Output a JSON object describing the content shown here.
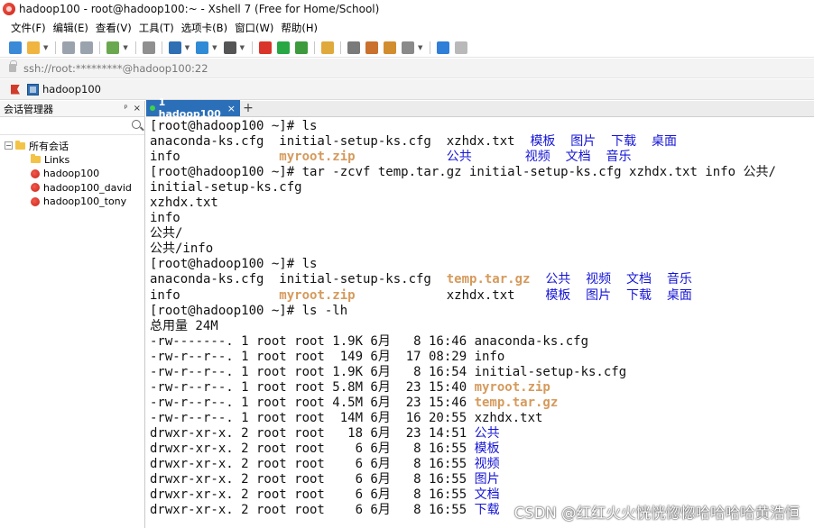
{
  "window": {
    "title": "hadoop100 - root@hadoop100:~ - Xshell 7 (Free for Home/School)"
  },
  "menu": [
    "文件(F)",
    "编辑(E)",
    "查看(V)",
    "工具(T)",
    "选项卡(B)",
    "窗口(W)",
    "帮助(H)"
  ],
  "toolbar": {
    "buttons": [
      {
        "name": "new-session-icon",
        "color": "#3a8ad8"
      },
      {
        "name": "open-folder-icon",
        "color": "#f0b540"
      },
      {
        "name": "connect-icon",
        "color": "#9aa3ad"
      },
      {
        "name": "disconnect-icon",
        "color": "#9aa3ad"
      },
      {
        "name": "reconnect-icon",
        "color": "#6aa84f"
      },
      {
        "name": "find-icon",
        "color": "#8f8f8f"
      },
      {
        "name": "properties-icon",
        "color": "#2f6fb3"
      },
      {
        "name": "globe-icon",
        "color": "#2f8bd6"
      },
      {
        "name": "font-icon",
        "color": "#555555"
      },
      {
        "name": "xshell-icon",
        "color": "#d9352a"
      },
      {
        "name": "xftp-icon",
        "color": "#28a745"
      },
      {
        "name": "fullscreen-icon",
        "color": "#3c9b3c"
      },
      {
        "name": "lock-icon",
        "color": "#e0a93c"
      },
      {
        "name": "keyboard-icon",
        "color": "#7a7a7a"
      },
      {
        "name": "highlight-icon",
        "color": "#c9712d"
      },
      {
        "name": "compose-icon",
        "color": "#d28d2e"
      },
      {
        "name": "layout-icon",
        "color": "#8a8a8a"
      },
      {
        "name": "help-icon",
        "color": "#2f7ed8"
      },
      {
        "name": "chat-icon",
        "color": "#b9b9b9"
      }
    ]
  },
  "address": {
    "text": "ssh://root:*********@hadoop100:22"
  },
  "session_bar": {
    "label": "hadoop100"
  },
  "session_manager": {
    "title": "会话管理器",
    "pin": "ᵖ",
    "close": "×",
    "tree": [
      {
        "label": "所有会话",
        "kind": "root",
        "expander": "−"
      },
      {
        "label": "Links",
        "kind": "folder"
      },
      {
        "label": "hadoop100",
        "kind": "session"
      },
      {
        "label": "hadoop100_david",
        "kind": "session"
      },
      {
        "label": "hadoop100_tony",
        "kind": "session"
      }
    ]
  },
  "tabs": [
    {
      "label": "1 hadoop100",
      "close": "×"
    }
  ],
  "tab_add": "+",
  "terminal": {
    "lines": [
      [
        {
          "t": "[root@hadoop100 ~]# ls"
        }
      ],
      [
        {
          "t": "anaconda-ks.cfg  initial-setup-ks.cfg  xzhdx.txt  "
        },
        {
          "t": "模板",
          "c": "link"
        },
        {
          "t": "  "
        },
        {
          "t": "图片",
          "c": "link"
        },
        {
          "t": "  "
        },
        {
          "t": "下载",
          "c": "link"
        },
        {
          "t": "  "
        },
        {
          "t": "桌面",
          "c": "link"
        }
      ],
      [
        {
          "t": "info             "
        },
        {
          "t": "myroot.zip",
          "c": "orange"
        },
        {
          "t": "            "
        },
        {
          "t": "公共",
          "c": "link"
        },
        {
          "t": "       "
        },
        {
          "t": "视频",
          "c": "link"
        },
        {
          "t": "  "
        },
        {
          "t": "文档",
          "c": "link"
        },
        {
          "t": "  "
        },
        {
          "t": "音乐",
          "c": "link"
        }
      ],
      [
        {
          "t": "[root@hadoop100 ~]# tar -zcvf temp.tar.gz initial-setup-ks.cfg xzhdx.txt info 公共/"
        }
      ],
      [
        {
          "t": "initial-setup-ks.cfg"
        }
      ],
      [
        {
          "t": "xzhdx.txt"
        }
      ],
      [
        {
          "t": "info"
        }
      ],
      [
        {
          "t": "公共/"
        }
      ],
      [
        {
          "t": "公共/info"
        }
      ],
      [
        {
          "t": "[root@hadoop100 ~]# ls"
        }
      ],
      [
        {
          "t": "anaconda-ks.cfg  initial-setup-ks.cfg  "
        },
        {
          "t": "temp.tar.gz",
          "c": "orange"
        },
        {
          "t": "  "
        },
        {
          "t": "公共",
          "c": "link"
        },
        {
          "t": "  "
        },
        {
          "t": "视频",
          "c": "link"
        },
        {
          "t": "  "
        },
        {
          "t": "文档",
          "c": "link"
        },
        {
          "t": "  "
        },
        {
          "t": "音乐",
          "c": "link"
        }
      ],
      [
        {
          "t": "info             "
        },
        {
          "t": "myroot.zip",
          "c": "orange"
        },
        {
          "t": "            xzhdx.txt    "
        },
        {
          "t": "模板",
          "c": "link"
        },
        {
          "t": "  "
        },
        {
          "t": "图片",
          "c": "link"
        },
        {
          "t": "  "
        },
        {
          "t": "下载",
          "c": "link"
        },
        {
          "t": "  "
        },
        {
          "t": "桌面",
          "c": "link"
        }
      ],
      [
        {
          "t": "[root@hadoop100 ~]# ls -lh"
        }
      ],
      [
        {
          "t": "总用量 24M"
        }
      ],
      [
        {
          "t": "-rw-------. 1 root root 1.9K 6月   8 16:46 anaconda-ks.cfg"
        }
      ],
      [
        {
          "t": "-rw-r--r--. 1 root root  149 6月  17 08:29 info"
        }
      ],
      [
        {
          "t": "-rw-r--r--. 1 root root 1.9K 6月   8 16:54 initial-setup-ks.cfg"
        }
      ],
      [
        {
          "t": "-rw-r--r--. 1 root root 5.8M 6月  23 15:40 "
        },
        {
          "t": "myroot.zip",
          "c": "orange"
        }
      ],
      [
        {
          "t": "-rw-r--r--. 1 root root 4.5M 6月  23 15:46 "
        },
        {
          "t": "temp.tar.gz",
          "c": "orange"
        }
      ],
      [
        {
          "t": "-rw-r--r--. 1 root root  14M 6月  16 20:55 xzhdx.txt"
        }
      ],
      [
        {
          "t": "drwxr-xr-x. 2 root root   18 6月  23 14:51 "
        },
        {
          "t": "公共",
          "c": "link"
        }
      ],
      [
        {
          "t": "drwxr-xr-x. 2 root root    6 6月   8 16:55 "
        },
        {
          "t": "模板",
          "c": "link"
        }
      ],
      [
        {
          "t": "drwxr-xr-x. 2 root root    6 6月   8 16:55 "
        },
        {
          "t": "视频",
          "c": "link"
        }
      ],
      [
        {
          "t": "drwxr-xr-x. 2 root root    6 6月   8 16:55 "
        },
        {
          "t": "图片",
          "c": "link"
        }
      ],
      [
        {
          "t": "drwxr-xr-x. 2 root root    6 6月   8 16:55 "
        },
        {
          "t": "文档",
          "c": "link"
        }
      ],
      [
        {
          "t": "drwxr-xr-x. 2 root root    6 6月   8 16:55 "
        },
        {
          "t": "下载",
          "c": "link"
        }
      ]
    ]
  },
  "watermark": "CSDN @红红火火恍恍惚惚哈哈哈哈黄浩恒"
}
